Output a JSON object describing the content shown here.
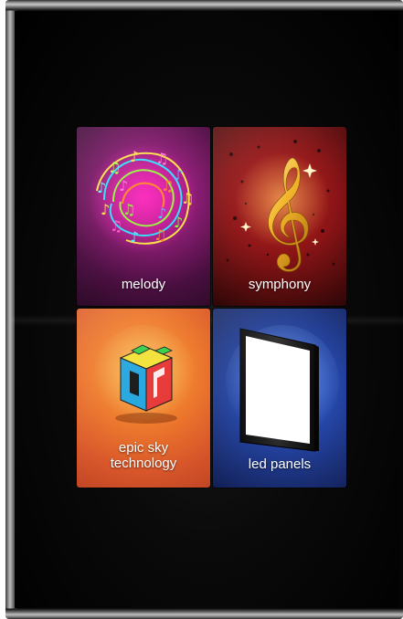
{
  "tiles": {
    "melody": {
      "label": "melody",
      "icon": "music-notes-icon",
      "color": "#8a1d73"
    },
    "symphony": {
      "label": "symphony",
      "icon": "treble-clef-icon",
      "color": "#8a1416"
    },
    "epic_sky": {
      "label_line1": "epic sky",
      "label_line2": "technology",
      "icon": "cube-logo-icon",
      "color": "#ee7a2d"
    },
    "led_panels": {
      "label": "led panels",
      "icon": "led-panel-icon",
      "color": "#2547a8"
    }
  }
}
